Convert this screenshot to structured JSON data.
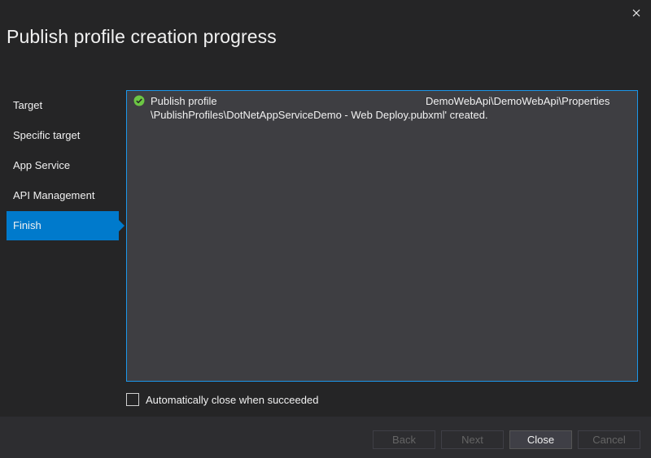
{
  "dialog": {
    "title": "Publish profile creation progress",
    "close_icon": "close-icon"
  },
  "nav": {
    "items": [
      {
        "label": "Target",
        "active": false
      },
      {
        "label": "Specific target",
        "active": false
      },
      {
        "label": "App Service",
        "active": false
      },
      {
        "label": "API Management",
        "active": false
      },
      {
        "label": "Finish",
        "active": true
      }
    ]
  },
  "output": {
    "status_icon": "check-circle-icon",
    "line1": "Publish profile",
    "line1_path": "DemoWebApi\\DemoWebApi\\Properties",
    "line2": "\\PublishProfiles\\DotNetAppServiceDemo - Web Deploy.pubxml' created."
  },
  "options": {
    "auto_close_label": "Automatically close when succeeded",
    "auto_close_checked": false
  },
  "buttons": {
    "back": "Back",
    "next": "Next",
    "close": "Close",
    "cancel": "Cancel"
  },
  "colors": {
    "accent": "#007acc",
    "success": "#6cc644",
    "background": "#252526",
    "panel": "#3e3e42"
  }
}
